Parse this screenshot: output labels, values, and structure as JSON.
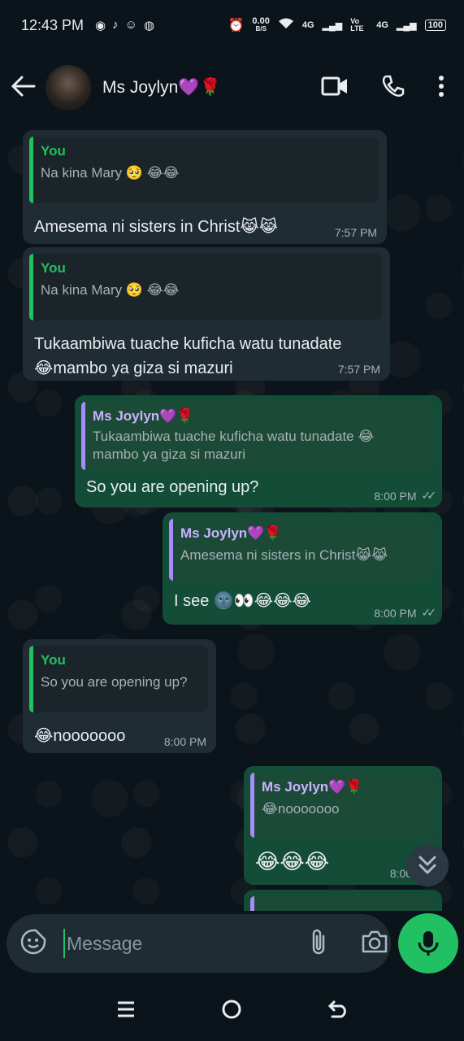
{
  "status_bar": {
    "time": "12:43 PM",
    "speed_value": "0.00",
    "speed_unit": "B/S",
    "network1": "4G",
    "volte": "Vo LTE",
    "network2": "4G",
    "battery": "100"
  },
  "header": {
    "contact_name": "Ms Joylyn💜🌹"
  },
  "messages": [
    {
      "direction": "incoming",
      "quote_author": "You",
      "quote_text": "Na kina Mary 🥺 😂😂",
      "body": "Amesema ni sisters in Christ😹😹",
      "time": "7:57 PM"
    },
    {
      "direction": "incoming",
      "quote_author": "You",
      "quote_text": "Na kina Mary 🥺 😂😂",
      "body": "Tukaambiwa tuache kuficha watu tunadate 😂mambo ya giza si mazuri",
      "time": "7:57 PM"
    },
    {
      "direction": "outgoing",
      "quote_author": "Ms Joylyn💜🌹",
      "quote_text": "Tukaambiwa tuache kuficha watu tunadate 😂 mambo ya giza si mazuri",
      "body": "So you are opening up?",
      "time": "8:00 PM"
    },
    {
      "direction": "outgoing",
      "quote_author": "Ms Joylyn💜🌹",
      "quote_text": "Amesema ni sisters in Christ😹😹",
      "body": "I see 🌚👀😂😂😂",
      "time": "8:00 PM"
    },
    {
      "direction": "incoming",
      "quote_author": "You",
      "quote_text": "So you are opening up?",
      "body": "😂nooooooo",
      "time": "8:00 PM"
    },
    {
      "direction": "outgoing",
      "quote_author": "Ms Joylyn💜🌹",
      "quote_text": "😂nooooooo",
      "body": "😂😂😂",
      "time": "8:00 PM"
    }
  ],
  "composer": {
    "placeholder": "Message"
  },
  "colors": {
    "accent": "#21c063",
    "incoming_bubble": "#202c33",
    "outgoing_bubble": "#144d37",
    "background": "#0b141a"
  }
}
